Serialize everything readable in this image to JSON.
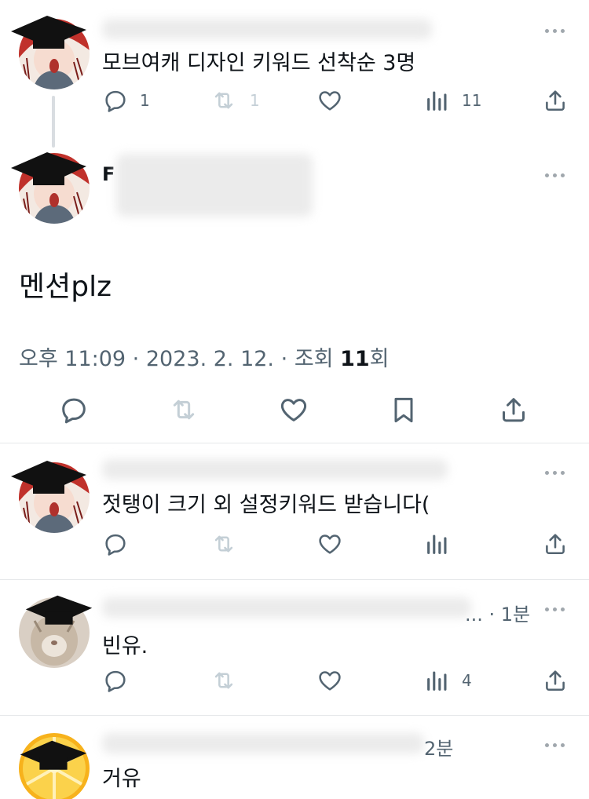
{
  "thread": {
    "parent": {
      "text": "모브여캐 디자인 키워드 선착순 3명",
      "reply_count": "1",
      "retweet_count": "1",
      "view_count": "11"
    },
    "main": {
      "name_fragment": "F",
      "text": "멘션plz",
      "time": "오후 11:09",
      "sep": "·",
      "date": "2023. 2. 12.",
      "views_label": "조회",
      "views_value": "11",
      "views_suffix": "회"
    }
  },
  "replies": [
    {
      "text": "젓탱이 크기 외 설정키워드 받습니다(",
      "time": "",
      "reply_count": "",
      "view_count": ""
    },
    {
      "text": "빈유.",
      "time": "... · 1분",
      "reply_count": "",
      "view_count": "4"
    },
    {
      "text": "거유",
      "time": "2분",
      "reply_count": "",
      "view_count": ""
    }
  ],
  "icons": {
    "reply": "speech-bubble-icon",
    "retweet": "retweet-icon",
    "like": "heart-icon",
    "views": "bar-chart-icon",
    "share": "share-icon",
    "bookmark": "bookmark-icon",
    "more": "more-dots-icon"
  },
  "colors": {
    "text_primary": "#0f1419",
    "text_secondary": "#536471",
    "icon": "#536471",
    "retweet_disabled": "#c4cfd6",
    "divider": "#e6e8ea",
    "censor_hat": "#111111"
  }
}
